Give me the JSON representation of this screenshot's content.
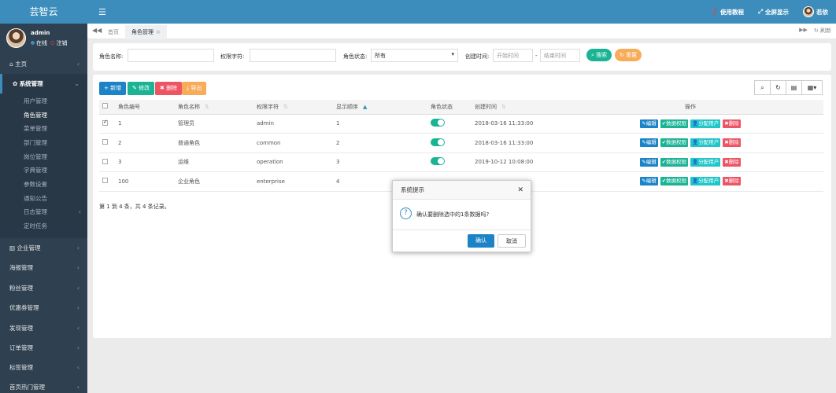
{
  "sidebar": {
    "logo": "芸智云",
    "user": {
      "name": "admin",
      "status": "在线",
      "logout": "注销"
    },
    "items": [
      {
        "label": "主页",
        "icon": "home-icon"
      },
      {
        "label": "系统管理",
        "icon": "gear-icon"
      },
      {
        "label": "企业管理",
        "icon": "bank-icon"
      },
      {
        "label": "海报管理"
      },
      {
        "label": "粉丝管理"
      },
      {
        "label": "优惠券管理"
      },
      {
        "label": "发现管理"
      },
      {
        "label": "订单管理"
      },
      {
        "label": "标签管理"
      },
      {
        "label": "首页热门管理"
      }
    ],
    "submenu": [
      "用户管理",
      "角色管理",
      "菜单管理",
      "部门管理",
      "岗位管理",
      "字典管理",
      "参数设置",
      "通知公告",
      "日志管理",
      "定时任务"
    ]
  },
  "topbar": {
    "tutorial": "使用教程",
    "fullscreen": "全屏显示",
    "username": "若依"
  },
  "tabs": {
    "home": "首页",
    "current": "角色管理",
    "refresh": "刷新"
  },
  "search": {
    "role_name_label": "角色名称:",
    "role_key_label": "权限字符:",
    "status_label": "角色状态:",
    "status_value": "所有",
    "created_label": "创建时间:",
    "start_placeholder": "开始时间",
    "dash": "-",
    "end_placeholder": "结束时间",
    "search_btn": "搜索",
    "reset_btn": "重置"
  },
  "toolbar": {
    "add": "新增",
    "edit": "修改",
    "delete": "删除",
    "export": "导出"
  },
  "table": {
    "headers": [
      "角色编号",
      "角色名称",
      "权限字符",
      "显示顺序",
      "角色状态",
      "创建时间",
      "操作"
    ],
    "rows": [
      {
        "id": "1",
        "name": "管理员",
        "key": "admin",
        "order": "1",
        "created": "2018-03-16 11:33:00",
        "checked": true
      },
      {
        "id": "2",
        "name": "普通角色",
        "key": "common",
        "order": "2",
        "created": "2018-03-16 11:33:00",
        "checked": false
      },
      {
        "id": "3",
        "name": "运维",
        "key": "operation",
        "order": "3",
        "created": "2019-10-12 10:08:00",
        "checked": false
      },
      {
        "id": "100",
        "name": "企业角色",
        "key": "enterprise",
        "order": "4",
        "created": "",
        "checked": false
      }
    ],
    "ops": {
      "edit": "编辑",
      "data_perm": "数据权限",
      "assign": "分配用户",
      "delete": "删除"
    },
    "pager": "第 1 到 4 条，共 4 条记录。"
  },
  "dialog": {
    "title": "系统提示",
    "message": "确认要删除选中的1条数据吗?",
    "confirm": "确认",
    "cancel": "取消"
  },
  "colors": {
    "primary": "#3c8dbc",
    "sidebar": "#2f4050",
    "success": "#1ab394",
    "danger": "#ed5565",
    "warning": "#f8ac59"
  }
}
